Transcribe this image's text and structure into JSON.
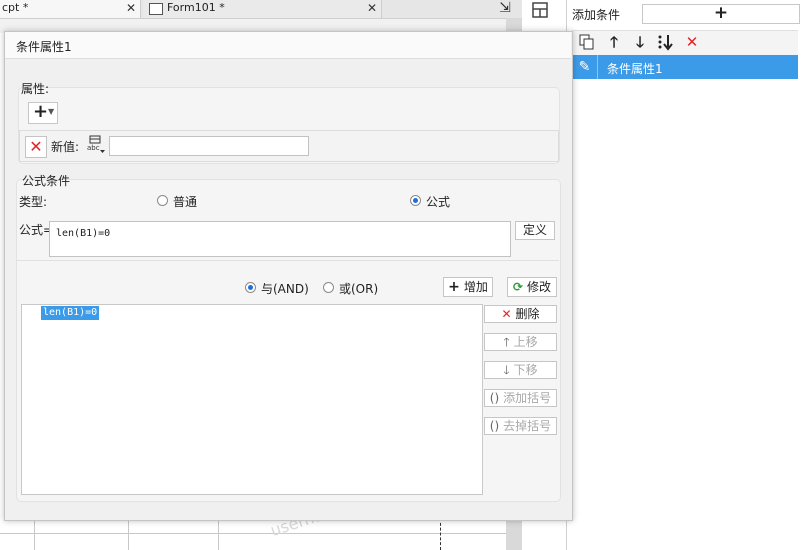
{
  "editor": {
    "tab1": "cpt *",
    "tab2": "Form101 *",
    "watermark": "username"
  },
  "conditions_panel": {
    "add_label": "添加条件",
    "add_button": "+",
    "toolbar_icons": [
      "copy-icon",
      "arrow-up-icon",
      "arrow-down-icon",
      "sort-down-icon",
      "delete-icon"
    ],
    "items": [
      {
        "label": "条件属性1",
        "selected": true
      }
    ]
  },
  "dialog": {
    "title": "条件属性1",
    "property": {
      "section_label": "属性:",
      "add_button": "+",
      "new_value_label": "新值:",
      "abc_icon_text": "abc",
      "new_value": ""
    },
    "formula_condition": {
      "section_label": "公式条件",
      "type_label": "类型:",
      "type_options": [
        {
          "label": "普通",
          "selected": false
        },
        {
          "label": "公式",
          "selected": true
        }
      ],
      "formula_label": "公式=",
      "formula_value": "len(B1)=0",
      "define_button": "定义",
      "logic_options": [
        {
          "label": "与(AND)",
          "selected": true
        },
        {
          "label": "或(OR)",
          "selected": false
        }
      ],
      "add_button": "增加",
      "modify_button": "修改",
      "delete_button": "删除",
      "move_up_button": "上移",
      "move_down_button": "下移",
      "add_bracket_button": "添加括号",
      "remove_bracket_button": "去掉括号",
      "conditions": [
        "len(B1)=0"
      ]
    }
  },
  "colors": {
    "accent": "#3c9be8",
    "delete_red": "#e02626",
    "add_green": "#2e9b3c"
  }
}
